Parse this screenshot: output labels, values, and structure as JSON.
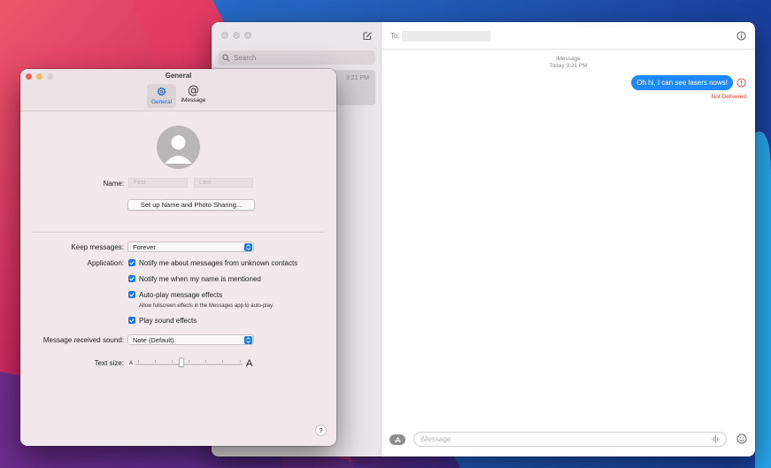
{
  "colors": {
    "accent": "#1e78ec",
    "bubble": "#1e88ff",
    "error": "#ef3b2c",
    "close": "#ee5c56",
    "minimize": "#f5bd4f",
    "zoom": "#d4cfd2"
  },
  "messages_window": {
    "search_placeholder": "Search",
    "conversation_time": "3:21 PM",
    "to_label": "To:",
    "service_label": "iMessage",
    "time_label": "Today 3:21 PM",
    "bubble_text": "Oh hi, I can see lasers nows!",
    "status_text": "Not Delivered",
    "input_placeholder": "iMessage",
    "icons": [
      "compose-icon",
      "search-icon",
      "info-icon",
      "error-icon",
      "app-store-icon",
      "audio-wave-icon",
      "emoji-icon"
    ]
  },
  "preferences": {
    "title": "General",
    "tabs": [
      {
        "label": "General",
        "icon": "gear-icon",
        "active": true
      },
      {
        "label": "iMessage",
        "icon": "at-sign-icon",
        "active": false
      }
    ],
    "name_label": "Name:",
    "first_placeholder": "First",
    "last_placeholder": "Last",
    "share_button": "Set up Name and Photo Sharing...",
    "keep_messages_label": "Keep messages:",
    "keep_messages_value": "Forever",
    "application_label": "Application:",
    "options": [
      {
        "label": "Notify me about messages from unknown contacts",
        "checked": true
      },
      {
        "label": "Notify me when my name is mentioned",
        "checked": true
      },
      {
        "label": "Auto-play message effects",
        "checked": true
      },
      {
        "label": "Play sound effects",
        "checked": true
      }
    ],
    "effects_hint": "Allow fullscreen effects in the Messages app to auto-play.",
    "sound_label": "Message received sound:",
    "sound_value": "Note (Default)",
    "text_size_label": "Text size:",
    "text_size_small": "A",
    "text_size_large": "A",
    "text_size_level": 0.43,
    "help_label": "?"
  }
}
